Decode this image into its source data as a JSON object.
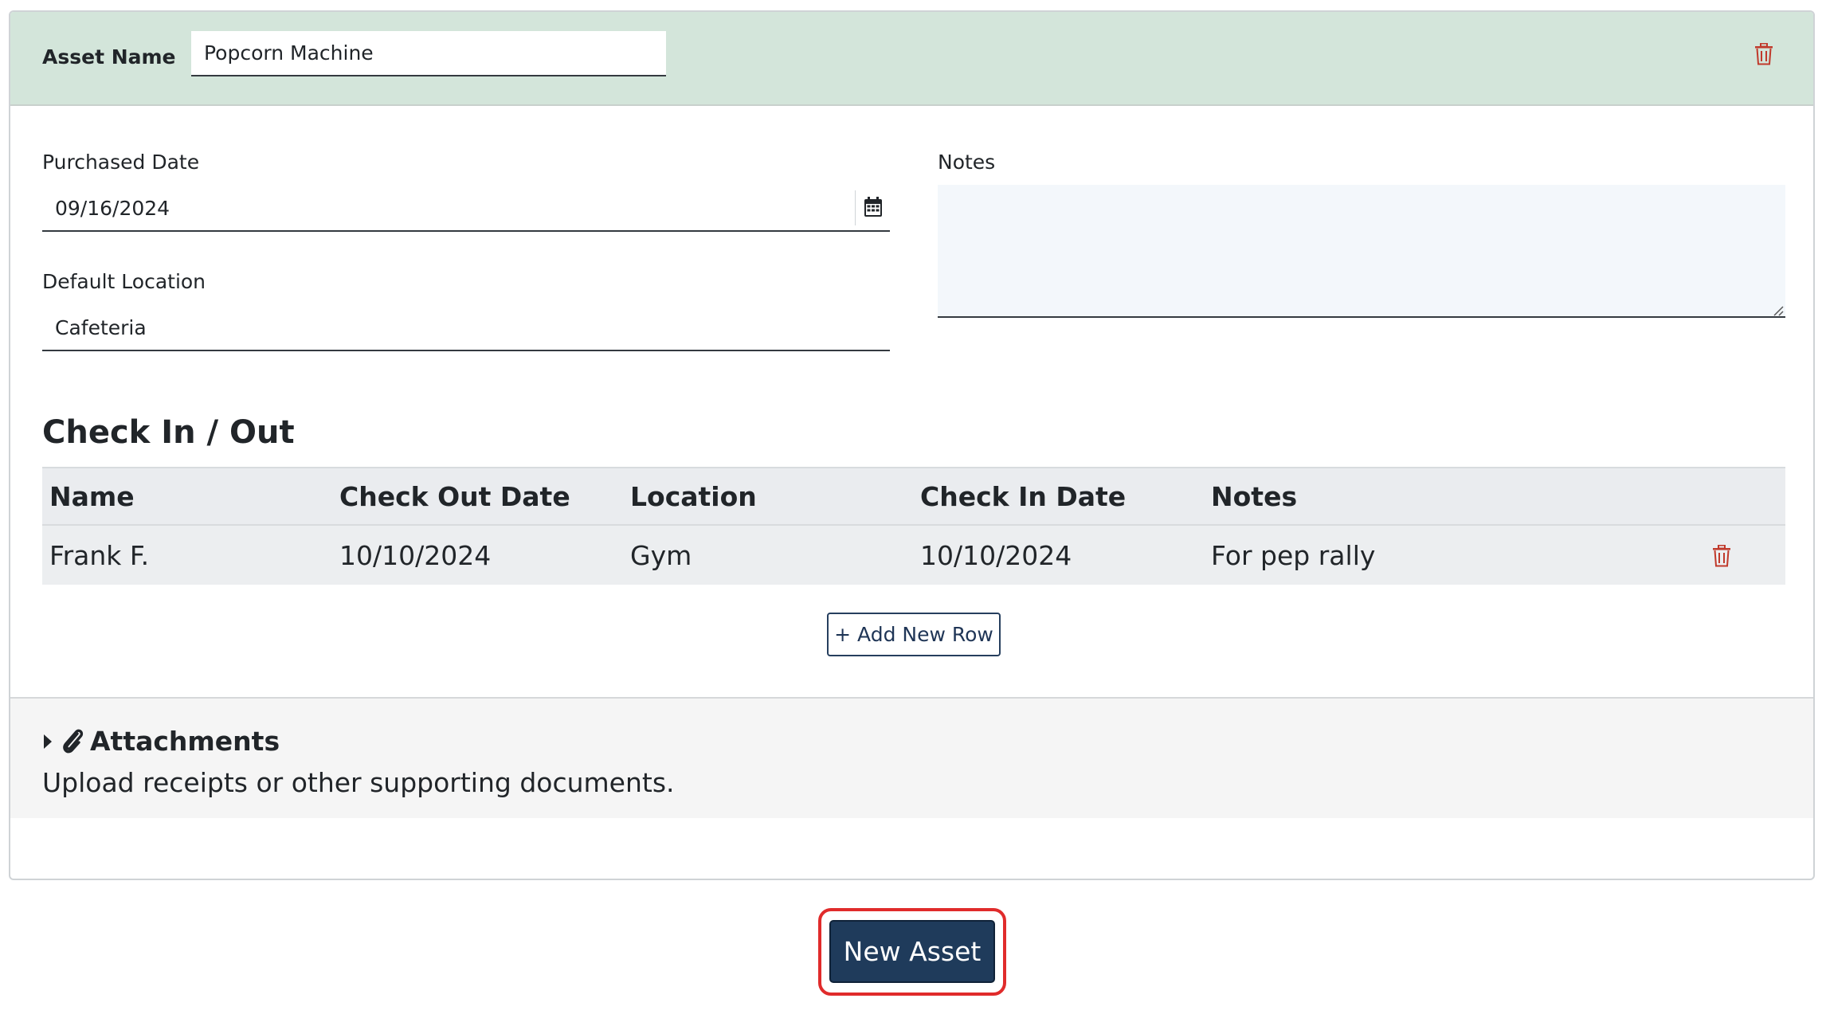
{
  "asset": {
    "name_label": "Asset Name",
    "name_value": "Popcorn Machine",
    "purchased_date_label": "Purchased Date",
    "purchased_date_value": "09/16/2024",
    "default_location_label": "Default Location",
    "default_location_value": "Cafeteria",
    "notes_label": "Notes",
    "notes_value": ""
  },
  "checkinout": {
    "title": "Check In / Out",
    "columns": [
      "Name",
      "Check Out Date",
      "Location",
      "Check In Date",
      "Notes"
    ],
    "rows": [
      {
        "name": "Frank F.",
        "check_out_date": "10/10/2024",
        "location": "Gym",
        "check_in_date": "10/10/2024",
        "notes": "For pep rally"
      }
    ],
    "add_row_label": "+ Add New Row"
  },
  "attachments": {
    "title": "Attachments",
    "description": "Upload receipts or other supporting documents."
  },
  "actions": {
    "new_asset_label": "New Asset"
  },
  "colors": {
    "header_bg": "#d3e5da",
    "primary": "#1f3b5b",
    "danger": "#c0392b",
    "highlight": "#e02b2b"
  },
  "icons": {
    "delete": "trash-icon",
    "calendar": "calendar-icon",
    "expand": "caret-right-icon",
    "attachment": "paperclip-icon"
  }
}
